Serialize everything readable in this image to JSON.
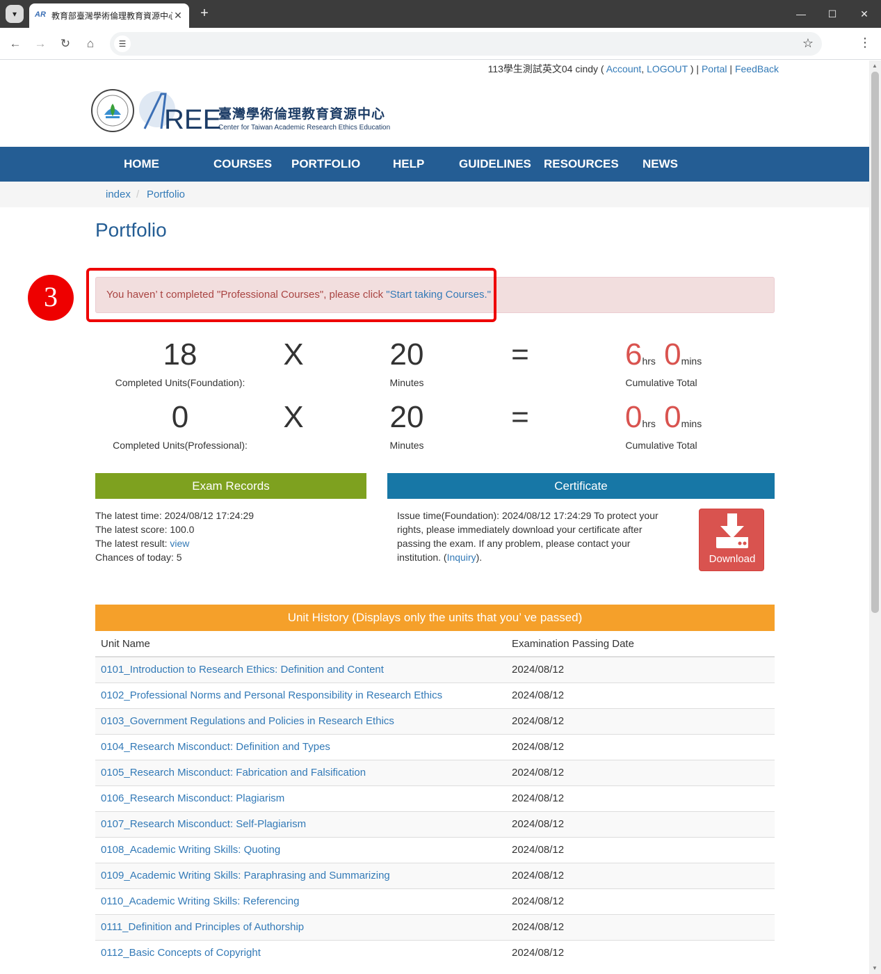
{
  "browser": {
    "tab_title": "教育部臺灣學術倫理教育資源中心",
    "tab_close": "✕",
    "new_tab": "+",
    "minimize": "—",
    "maximize": "☐",
    "close": "✕"
  },
  "userbar": {
    "user": "113學生測試英文04 cindy (",
    "account": "Account",
    "comma": ",",
    "logout": "LOGOUT",
    "close_paren": ") |",
    "portal": "Portal",
    "sep": "|",
    "feedback": "FeedBack"
  },
  "logo": {
    "cn": "臺灣學術倫理教育資源中心",
    "en": "Center for Taiwan Academic Research Ethics Education"
  },
  "nav": [
    "HOME",
    "COURSES",
    "PORTFOLIO",
    "HELP",
    "GUIDELINES",
    "RESOURCES",
    "NEWS"
  ],
  "breadcrumb": {
    "index": "index",
    "sep": "/",
    "current": "Portfolio"
  },
  "page_title": "Portfolio",
  "step_badge": "3",
  "alert": {
    "text": "You haven’ t completed \"Professional Courses\", please click ",
    "link": "\"Start taking Courses.\""
  },
  "stats": {
    "foundation": {
      "units": "18",
      "units_label": "Completed Units(Foundation):",
      "op": "X",
      "minutes": "20",
      "minutes_label": "Minutes",
      "eq": "=",
      "hrs": "6",
      "hrs_unit": "hrs",
      "mins": "0",
      "mins_unit": "mins",
      "total_label": "Cumulative Total"
    },
    "professional": {
      "units": "0",
      "units_label": "Completed Units(Professional):",
      "op": "X",
      "minutes": "20",
      "minutes_label": "Minutes",
      "eq": "=",
      "hrs": "0",
      "hrs_unit": "hrs",
      "mins": "0",
      "mins_unit": "mins",
      "total_label": "Cumulative Total"
    }
  },
  "exam": {
    "title": "Exam Records",
    "latest_time": "The latest time: 2024/08/12 17:24:29",
    "latest_score": "The latest score: 100.0",
    "latest_result_label": "The latest result: ",
    "latest_result_link": "view",
    "chances": "Chances of today: 5"
  },
  "certificate": {
    "title": "Certificate",
    "text": "Issue time(Foundation): 2024/08/12 17:24:29 To protect your rights, please immediately download your certificate after passing the exam. If any problem, please contact your institution. (",
    "inquiry": "Inquiry",
    "tail": ").",
    "download": "Download"
  },
  "history": {
    "title": "Unit History (Displays only the units that you’ ve passed)",
    "col_unit": "Unit Name",
    "col_date": "Examination Passing Date",
    "rows": [
      {
        "unit": "0101_Introduction to Research Ethics: Definition and Content",
        "date": "2024/08/12"
      },
      {
        "unit": "0102_Professional Norms and Personal Responsibility in Research Ethics",
        "date": "2024/08/12"
      },
      {
        "unit": "0103_Government Regulations and Policies in Research Ethics",
        "date": "2024/08/12"
      },
      {
        "unit": "0104_Research Misconduct: Definition and Types",
        "date": "2024/08/12"
      },
      {
        "unit": "0105_Research Misconduct: Fabrication and Falsification",
        "date": "2024/08/12"
      },
      {
        "unit": "0106_Research Misconduct: Plagiarism",
        "date": "2024/08/12"
      },
      {
        "unit": "0107_Research Misconduct: Self-Plagiarism",
        "date": "2024/08/12"
      },
      {
        "unit": "0108_Academic Writing Skills: Quoting",
        "date": "2024/08/12"
      },
      {
        "unit": "0109_Academic Writing Skills: Paraphrasing and Summarizing",
        "date": "2024/08/12"
      },
      {
        "unit": "0110_Academic Writing Skills: Referencing",
        "date": "2024/08/12"
      },
      {
        "unit": "0111_Definition and Principles of Authorship",
        "date": "2024/08/12"
      },
      {
        "unit": "0112_Basic Concepts of Copyright",
        "date": "2024/08/12"
      }
    ]
  },
  "colors": {
    "nav_bg": "#245d94",
    "exam_head": "#7ea11f",
    "cert_head": "#1777a6",
    "history_head": "#f5a02a",
    "alert_bg": "#f2dede",
    "highlight": "#ee0000",
    "total_red": "#d9534f"
  }
}
